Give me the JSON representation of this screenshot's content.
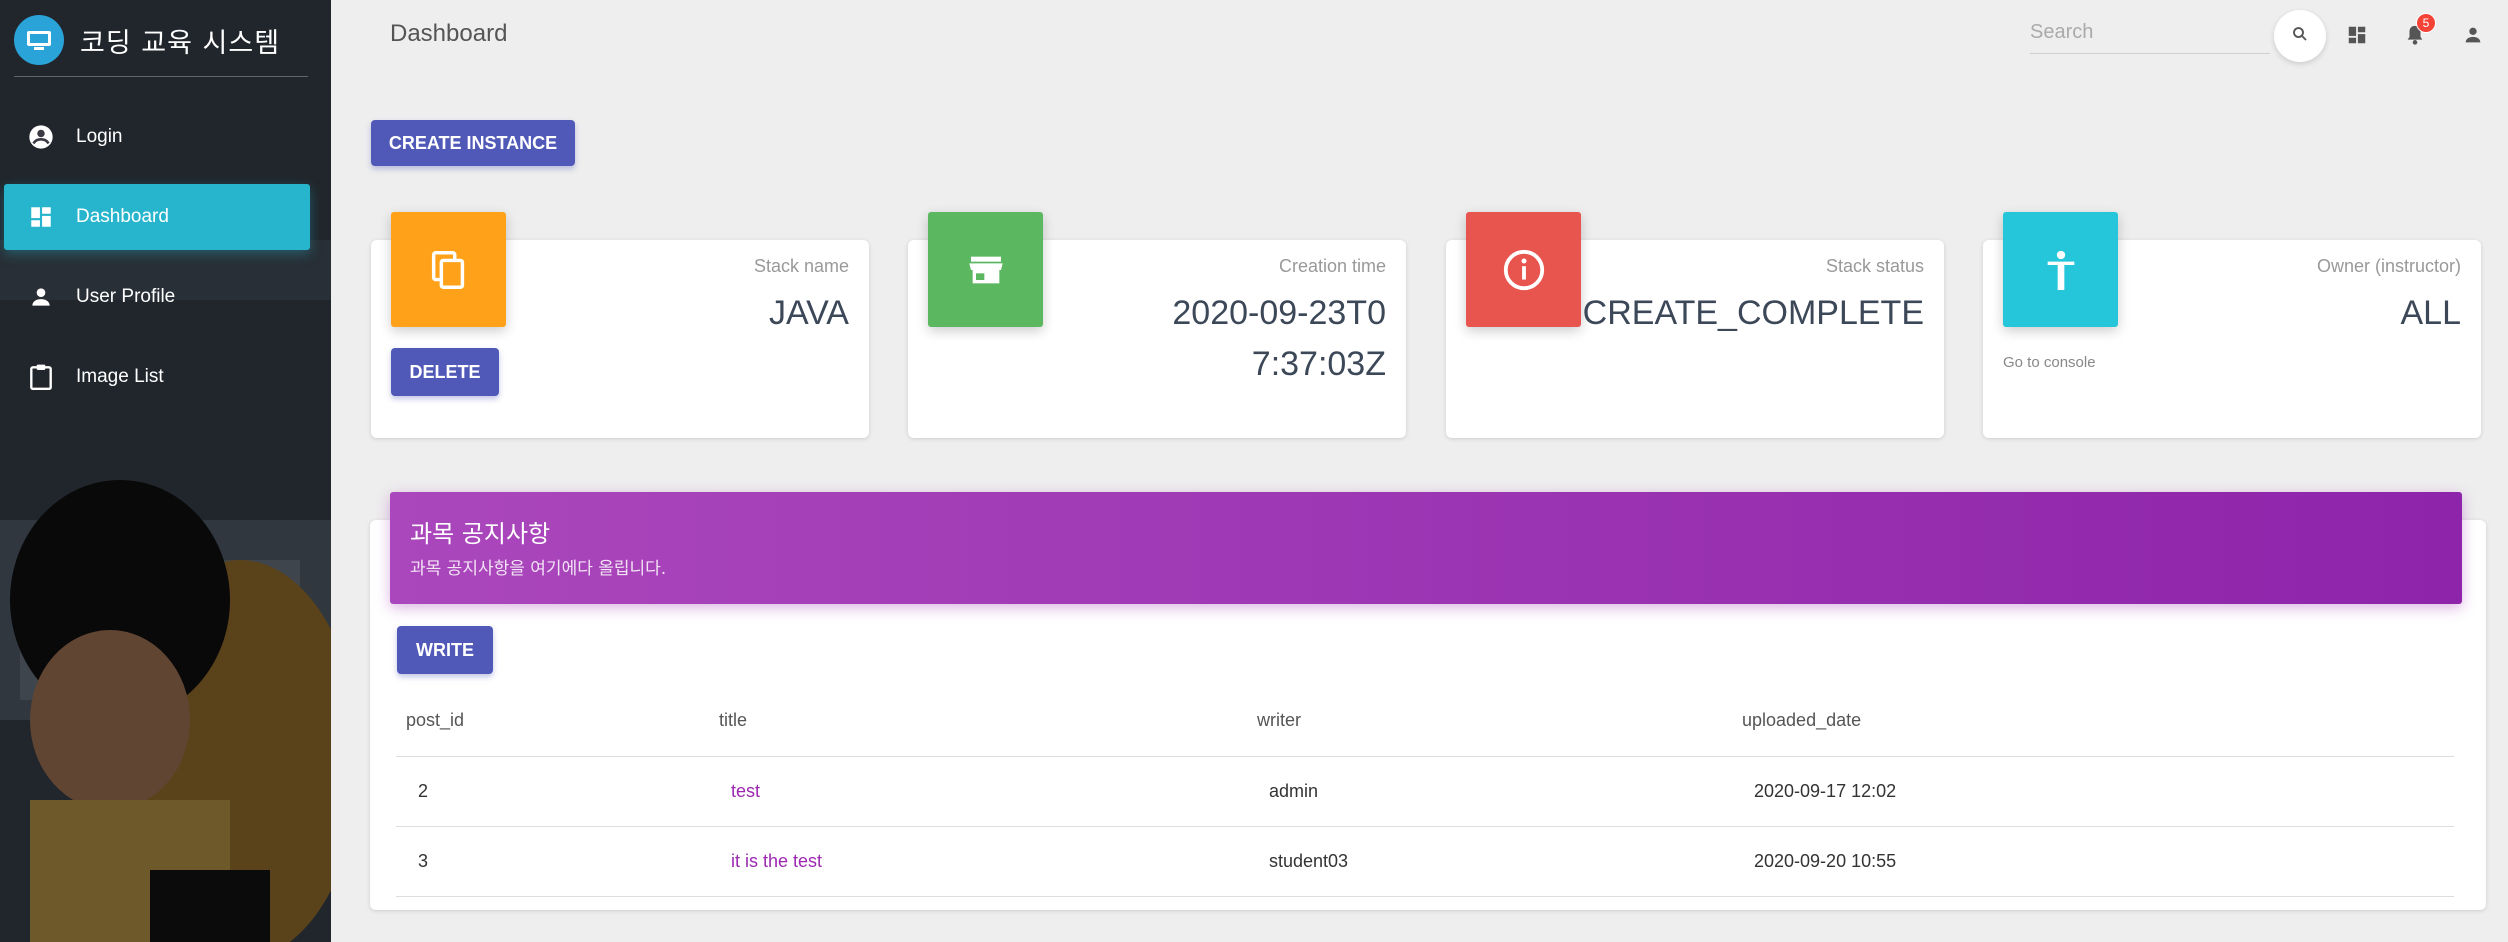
{
  "sidebar": {
    "brand": "코딩 교육 시스템",
    "items": [
      {
        "label": "Login",
        "icon": "account-circle-icon"
      },
      {
        "label": "Dashboard",
        "icon": "dashboard-icon",
        "active": true
      },
      {
        "label": "User Profile",
        "icon": "person-icon"
      },
      {
        "label": "Image List",
        "icon": "clipboard-icon"
      }
    ]
  },
  "header": {
    "title": "Dashboard",
    "search_placeholder": "Search",
    "notification_count": "5"
  },
  "actions": {
    "create_instance": "CREATE INSTANCE"
  },
  "cards": [
    {
      "category": "Stack name",
      "value": "JAVA",
      "action": "DELETE",
      "icon": "copy-icon",
      "color": "#ffa21a"
    },
    {
      "category": "Creation time",
      "value": "2020-09-23T07:37:03Z",
      "icon": "store-icon",
      "color": "#5cb860"
    },
    {
      "category": "Stack status",
      "value": "CREATE_COMPLETE",
      "icon": "info-icon",
      "color": "#e8554e"
    },
    {
      "category": "Owner (instructor)",
      "value": "ALL",
      "link": "Go to console",
      "icon": "accessibility-icon",
      "color": "#26c6da"
    }
  ],
  "notice": {
    "title": "과목 공지사항",
    "subtitle": "과목 공지사항을 여기에다 올립니다.",
    "write": "WRITE",
    "columns": [
      "post_id",
      "title",
      "writer",
      "uploaded_date"
    ],
    "rows": [
      {
        "post_id": "2",
        "title": "test",
        "writer": "admin",
        "uploaded_date": "2020-09-17 12:02"
      },
      {
        "post_id": "3",
        "title": "it is the test",
        "writer": "student03",
        "uploaded_date": "2020-09-20 10:55"
      }
    ]
  },
  "colors": {
    "primary": "#5059b8",
    "sidebar_active": "#26b5cc",
    "notice_header": "#9c27b0"
  }
}
